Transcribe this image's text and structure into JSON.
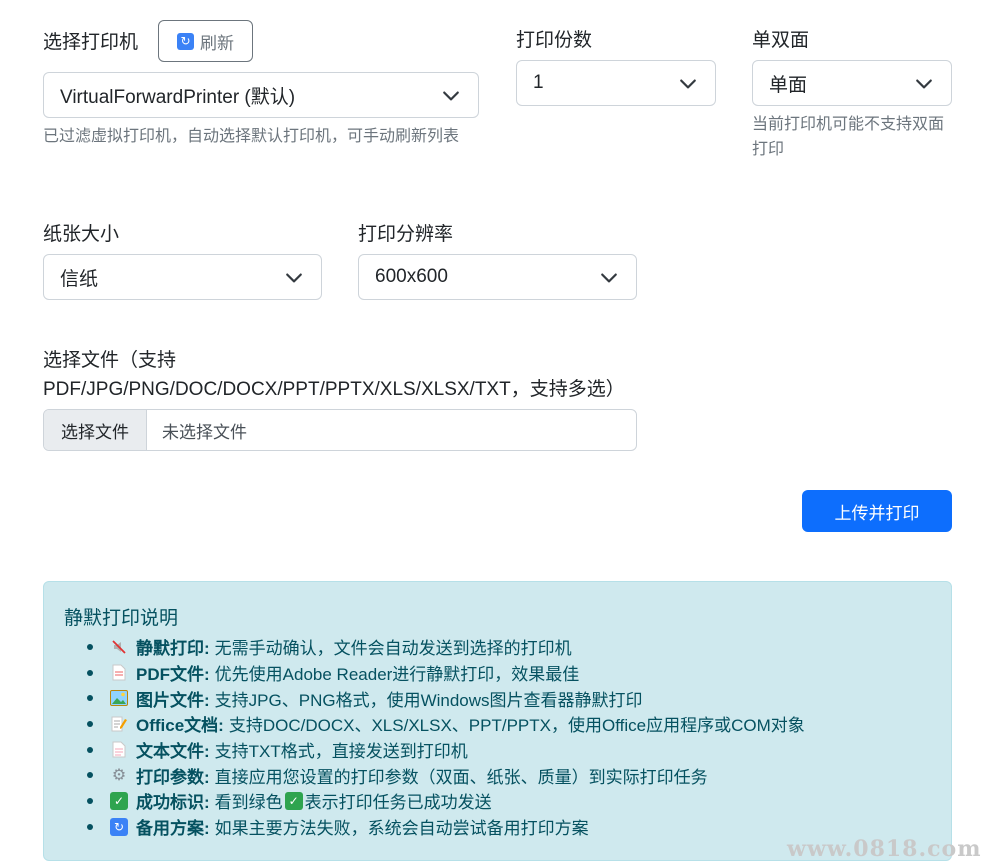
{
  "printer": {
    "label": "选择打印机",
    "refresh_label": "刷新",
    "selected": "VirtualForwardPrinter (默认)",
    "help": "已过滤虚拟打印机，自动选择默认打印机，可手动刷新列表"
  },
  "copies": {
    "label": "打印份数",
    "selected": "1"
  },
  "duplex": {
    "label": "单双面",
    "selected": "单面",
    "help": "当前打印机可能不支持双面打印"
  },
  "paper": {
    "label": "纸张大小",
    "selected": "信纸"
  },
  "resolution": {
    "label": "打印分辨率",
    "selected": "600x600"
  },
  "file": {
    "label_line1": "选择文件（支持",
    "label_line2": "PDF/JPG/PNG/DOC/DOCX/PPT/PPTX/XLS/XLSX/TXT，支持多选）",
    "button_label": "选择文件",
    "status": "未选择文件"
  },
  "submit_label": "上传并打印",
  "info": {
    "title": "静默打印说明",
    "items": [
      {
        "icon": "mute-icon",
        "title": "静默打印:",
        "text": "无需手动确认，文件会自动发送到选择的打印机"
      },
      {
        "icon": "document-icon",
        "title": "PDF文件:",
        "text": "优先使用Adobe Reader进行静默打印，效果最佳"
      },
      {
        "icon": "picture-icon",
        "title": "图片文件:",
        "text": "支持JPG、PNG格式，使用Windows图片查看器静默打印"
      },
      {
        "icon": "memo-icon",
        "title": "Office文档:",
        "text": "支持DOC/DOCX、XLS/XLSX、PPT/PPTX，使用Office应用程序或COM对象"
      },
      {
        "icon": "page-icon",
        "title": "文本文件:",
        "text": "支持TXT格式，直接发送到打印机"
      },
      {
        "icon": "gear-icon",
        "title": "打印参数:",
        "text": "直接应用您设置的打印参数（双面、纸张、质量）到实际打印任务"
      },
      {
        "icon": "check-icon",
        "title": "成功标识:",
        "text_before": "看到绿色",
        "text": "表示打印任务已成功发送"
      },
      {
        "icon": "refresh-icon",
        "title": "备用方案:",
        "text": "如果主要方法失败，系统会自动尝试备用打印方案"
      }
    ]
  },
  "watermark": "www.0818.com",
  "colors": {
    "primary": "#0d6efd",
    "info_bg": "#cfe9ee",
    "info_text": "#055160",
    "success": "#2ea44f",
    "refresh_icon": "#3b82f6"
  }
}
